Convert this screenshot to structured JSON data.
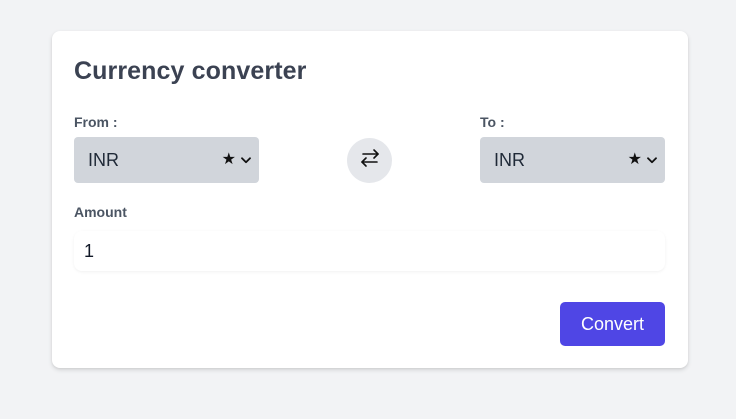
{
  "title": "Currency converter",
  "from": {
    "label": "From :",
    "value": "INR"
  },
  "to": {
    "label": "To :",
    "value": "INR"
  },
  "amount": {
    "label": "Amount",
    "value": "1"
  },
  "convert_label": "Convert",
  "icons": {
    "star": "star-icon",
    "chevron": "chevron-down-icon",
    "swap": "swap-arrows-icon"
  },
  "colors": {
    "page_background": "#f2f3f5",
    "card_background": "#ffffff",
    "select_background": "#d1d5db",
    "swap_background": "#e5e7eb",
    "accent": "#4f46e5"
  }
}
